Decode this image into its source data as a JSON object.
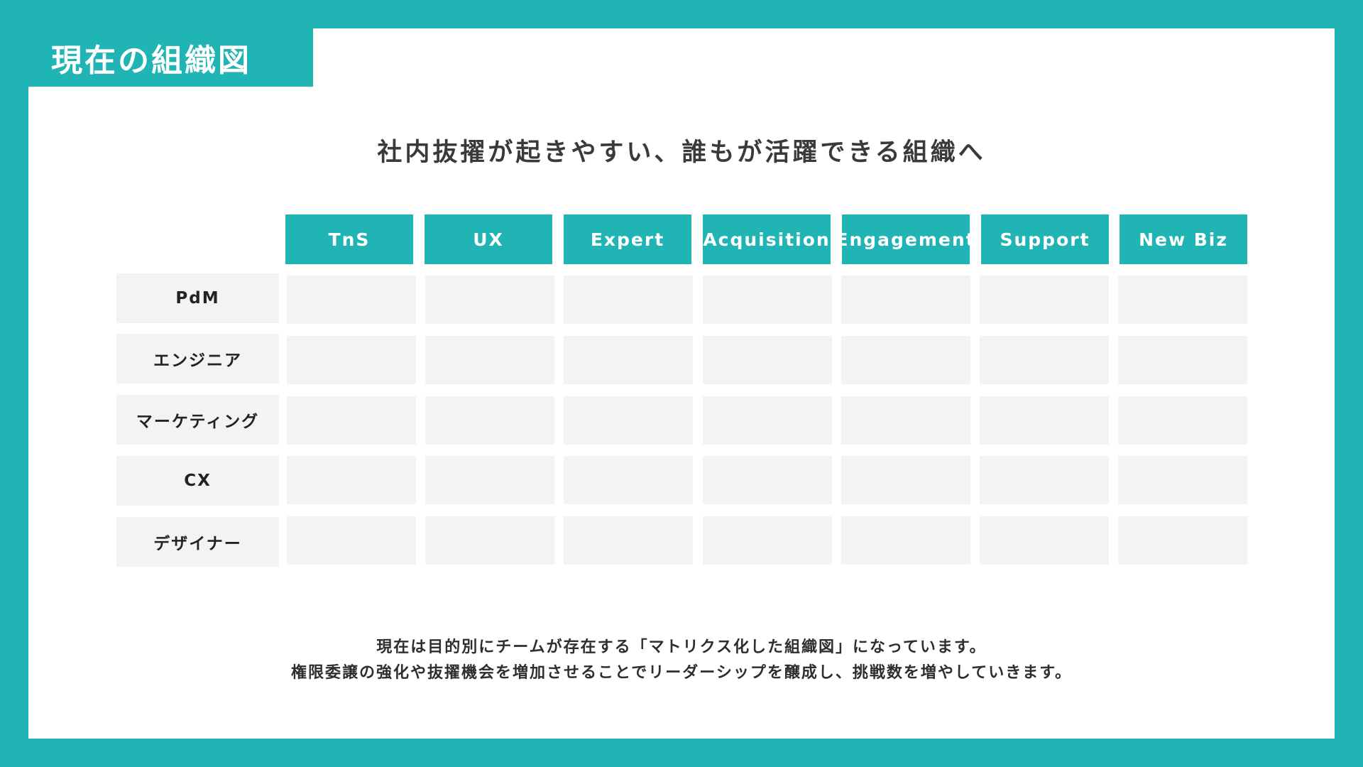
{
  "header": {
    "title": "現在の組織図"
  },
  "subtitle": "社内抜擢が起きやすい、誰もが活躍できる組織へ",
  "matrix": {
    "columns": [
      "TnS",
      "UX",
      "Expert",
      "Acquisition",
      "Engagement",
      "Support",
      "New Biz"
    ],
    "rows": [
      "PdM",
      "エンジニア",
      "マーケティング",
      "CX",
      "デザイナー"
    ]
  },
  "footer": {
    "line1": "現在は目的別にチームが存在する「マトリクス化した組織図」になっています。",
    "line2": "権限委譲の強化や抜擢機会を増加させることでリーダーシップを醸成し、挑戦数を増やしていきます。"
  },
  "colors": {
    "accent": "#21b4b4",
    "cell": "#f3f3f3"
  }
}
